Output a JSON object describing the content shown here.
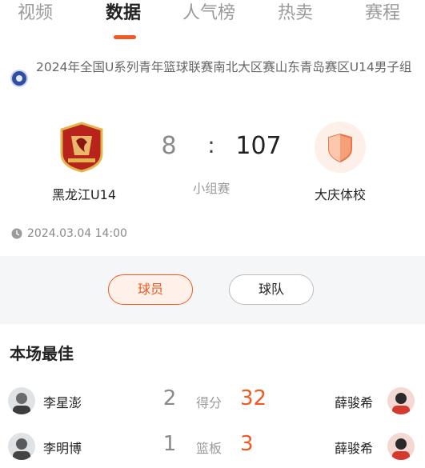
{
  "tabs": [
    {
      "label": "视频",
      "active": false
    },
    {
      "label": "数据",
      "active": true
    },
    {
      "label": "人气榜",
      "active": false
    },
    {
      "label": "热卖",
      "active": false
    },
    {
      "label": "赛程",
      "active": false
    }
  ],
  "match": {
    "league": "2024年全国U系列青年篮球联赛南北大区赛山东青岛赛区U14男子组",
    "team_a": {
      "name": "黑龙江U14",
      "score": "8"
    },
    "team_b": {
      "name": "大庆体校",
      "score": "107"
    },
    "colon": ":",
    "stage": "小组赛",
    "datetime": "2024.03.04 14:00"
  },
  "toggle": {
    "players_label": "球员",
    "team_label": "球队",
    "selected": "球员"
  },
  "best": {
    "title": "本场最佳",
    "rows": [
      {
        "player_a": "李星澎",
        "value_a": "2",
        "stat": "得分",
        "value_b": "32",
        "player_b": "薛骏希"
      },
      {
        "player_a": "李明博",
        "value_a": "1",
        "stat": "篮板",
        "value_b": "3",
        "player_b": "薛骏希"
      }
    ]
  },
  "colors": {
    "accent": "#f05a22",
    "muted": "#9a9a9a",
    "band": "#f5f6f8"
  }
}
